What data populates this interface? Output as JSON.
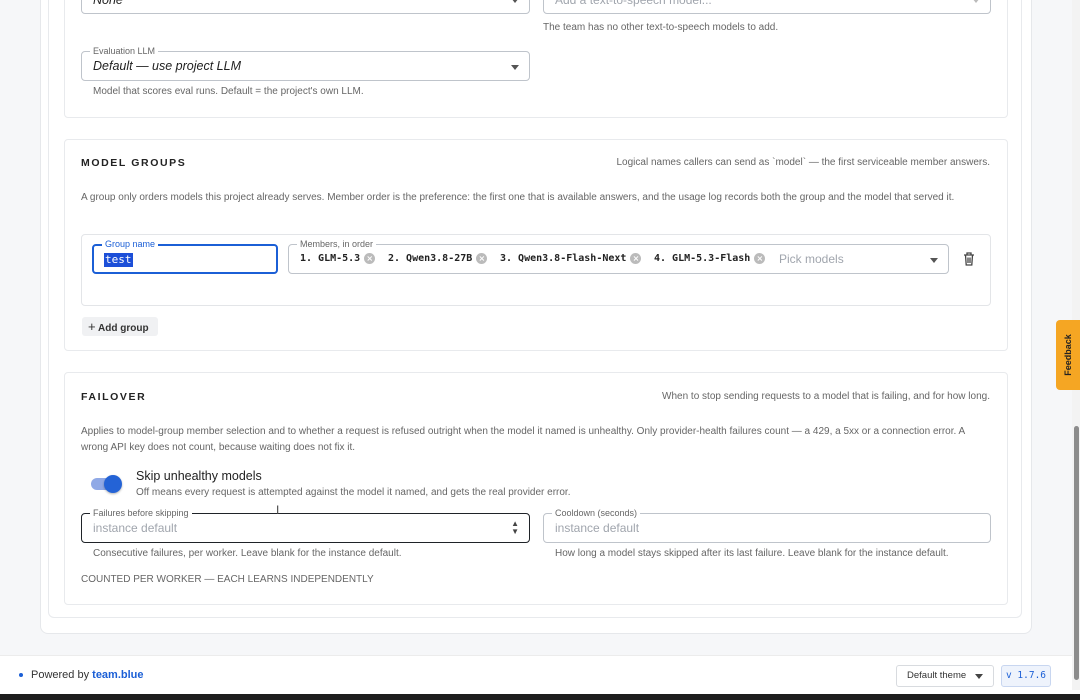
{
  "tts": {
    "select_value": "None",
    "add_placeholder": "Add a text-to-speech model...",
    "helper": "The team has no other text-to-speech models to add."
  },
  "eval_llm": {
    "label": "Evaluation LLM",
    "value": "Default — use project LLM",
    "helper": "Model that scores eval runs. Default = the project's own LLM."
  },
  "model_groups": {
    "title": "MODEL GROUPS",
    "note": "Logical names callers can send as `model` — the first serviceable member answers.",
    "description": "A group only orders models this project already serves. Member order is the preference: the first one that is available answers, and the usage log records both the group and the model that served it.",
    "group_name_label": "Group name",
    "group_name_value": "test",
    "members_label": "Members, in order",
    "members": [
      "1. GLM-5.3",
      "2. Qwen3.8-27B",
      "3. Qwen3.8-Flash-Next",
      "4. GLM-5.3-Flash"
    ],
    "members_placeholder": "Pick models",
    "add_group_label": "Add group"
  },
  "failover": {
    "title": "FAILOVER",
    "note": "When to stop sending requests to a model that is failing, and for how long.",
    "description": "Applies to model-group member selection and to whether a request is refused outright when the model it named is unhealthy. Only provider-health failures count — a 429, a 5xx or a connection error. A wrong API key does not count, because waiting does not fix it.",
    "toggle_label": "Skip unhealthy models",
    "toggle_on": true,
    "toggle_helper": "Off means every request is attempted against the model it named, and gets the real provider error.",
    "failures_label": "Failures before skipping",
    "failures_placeholder": "instance default",
    "failures_helper": "Consecutive failures, per worker. Leave blank for the instance default.",
    "cooldown_label": "Cooldown (seconds)",
    "cooldown_placeholder": "instance default",
    "cooldown_helper": "How long a model stays skipped after its last failure. Leave blank for the instance default.",
    "counted_note": "COUNTED PER WORKER — EACH LEARNS INDEPENDENTLY"
  },
  "footer": {
    "powered_prefix": "Powered by",
    "powered_brand": "team.blue",
    "theme": "Default theme",
    "version": "v 1.7.6"
  },
  "feedback_label": "Feedback",
  "colors": {
    "accent": "#1b5fd6",
    "feedback": "#f5a623"
  }
}
